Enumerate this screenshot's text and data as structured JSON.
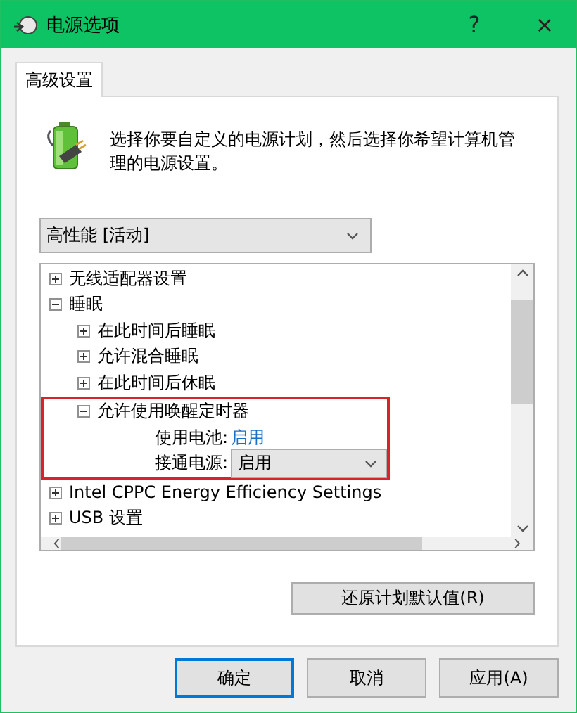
{
  "window": {
    "title": "电源选项",
    "help": "?",
    "close": "×"
  },
  "tabs": [
    {
      "label": "高级设置",
      "selected": true
    }
  ],
  "description": "选择你要自定义的电源计划，然后选择你希望计算机管理的电源设置。",
  "plan_select": {
    "value": "高性能 [活动]"
  },
  "tree": [
    {
      "label": "无线适配器设置",
      "expanded": false,
      "highlighted": false
    },
    {
      "label": "睡眠",
      "expanded": true,
      "highlighted": false,
      "children": [
        {
          "label": "在此时间后睡眠",
          "expanded": false,
          "highlighted": false
        },
        {
          "label": "允许混合睡眠",
          "expanded": false,
          "highlighted": false
        },
        {
          "label": "在此时间后休眠",
          "expanded": false,
          "highlighted": false
        },
        {
          "label": "允许使用唤醒定时器",
          "expanded": true,
          "highlighted": true,
          "settings": [
            {
              "kind": "link",
              "label": "使用电池:",
              "value": "启用"
            },
            {
              "kind": "select",
              "label": "接通电源:",
              "value": "启用"
            }
          ]
        }
      ]
    },
    {
      "label": "Intel CPPC Energy Efficiency Settings",
      "expanded": false,
      "highlighted": false
    },
    {
      "label": "USB 设置",
      "expanded": false,
      "highlighted": false
    }
  ],
  "restore_button": "还原计划默认值(R)",
  "buttons": [
    {
      "label": "确定",
      "default": true
    },
    {
      "label": "取消",
      "default": false
    },
    {
      "label": "应用(A)",
      "default": false
    }
  ]
}
